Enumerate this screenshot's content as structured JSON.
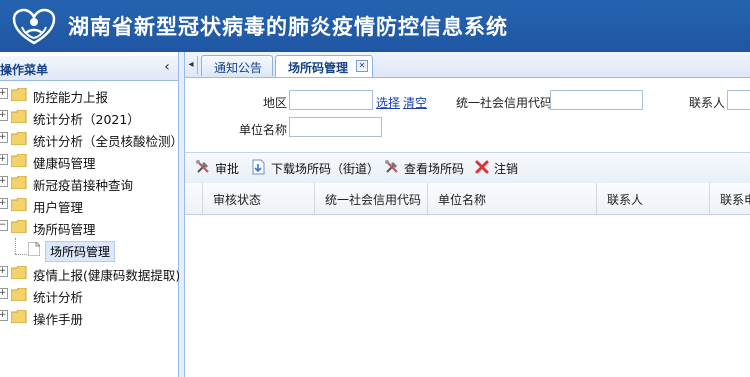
{
  "header": {
    "title": "湖南省新型冠状病毒的肺炎疫情防控信息系统",
    "bg_color": "#2563b0"
  },
  "sidebar": {
    "title": "操作菜单",
    "collapse_icon": "‹",
    "items": [
      {
        "label": "防控能力上报"
      },
      {
        "label": "统计分析（2021）"
      },
      {
        "label": "统计分析（全员核酸检测）"
      },
      {
        "label": "健康码管理"
      },
      {
        "label": "新冠疫苗接种查询"
      },
      {
        "label": "用户管理"
      },
      {
        "label": "场所码管理",
        "expanded": true
      },
      {
        "label": "疫情上报(健康码数据提取)"
      },
      {
        "label": "统计分析"
      },
      {
        "label": "操作手册"
      }
    ],
    "selected_leaf": "场所码管理"
  },
  "tabs": [
    {
      "label": "通知公告"
    },
    {
      "label": "场所码管理",
      "active": true
    }
  ],
  "form": {
    "region_label": "地区",
    "region_value": "",
    "select_link": "选择",
    "clear_link": "清空",
    "credit_code_label": "统一社会信用代码",
    "credit_code_value": "",
    "contact_label": "联系人",
    "contact_value": "",
    "unit_name_label": "单位名称",
    "unit_name_value": ""
  },
  "toolbar": {
    "approve": "审批",
    "download": "下载场所码（街道）",
    "view": "查看场所码",
    "cancel": "注销"
  },
  "grid": {
    "columns": [
      "审核状态",
      "统一社会信用代码",
      "单位名称",
      "联系人",
      "联系电"
    ]
  }
}
